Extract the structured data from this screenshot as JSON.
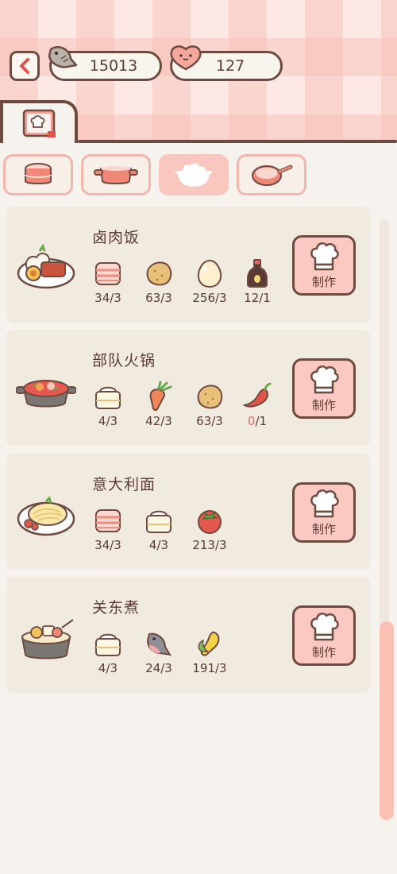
{
  "header": {
    "fish_count": "15013",
    "heart_count": "127"
  },
  "colors": {
    "accent": "#f9c7bd",
    "outline": "#6e4a40",
    "card": "#f1eadf",
    "shortage": "#e46a5e"
  },
  "category_tabs": [
    {
      "icon": "sushi-roll-icon",
      "active": false
    },
    {
      "icon": "pot-icon",
      "active": false
    },
    {
      "icon": "rice-bowl-icon",
      "active": true
    },
    {
      "icon": "frying-pan-icon",
      "active": false
    }
  ],
  "recipes": [
    {
      "name": "卤肉饭",
      "dish_icon": "braised-pork-rice-icon",
      "button_label": "制作",
      "ingredients": [
        {
          "icon": "meat-slab-icon",
          "count": "34/3"
        },
        {
          "icon": "potato-icon",
          "count": "63/3"
        },
        {
          "icon": "egg-icon",
          "count": "256/3"
        },
        {
          "icon": "soy-sauce-icon",
          "count": "12/1"
        }
      ]
    },
    {
      "name": "部队火锅",
      "dish_icon": "army-hotpot-icon",
      "button_label": "制作",
      "ingredients": [
        {
          "icon": "rice-cake-icon",
          "count": "4/3"
        },
        {
          "icon": "carrot-icon",
          "count": "42/3"
        },
        {
          "icon": "potato-icon",
          "count": "63/3"
        },
        {
          "icon": "chili-icon",
          "have": "0",
          "need": "/1"
        }
      ]
    },
    {
      "name": "意大利面",
      "dish_icon": "spaghetti-icon",
      "button_label": "制作",
      "ingredients": [
        {
          "icon": "meat-slab-icon",
          "count": "34/3"
        },
        {
          "icon": "rice-cake-icon",
          "count": "4/3"
        },
        {
          "icon": "tomato-icon",
          "count": "213/3"
        }
      ]
    },
    {
      "name": "关东煮",
      "dish_icon": "oden-icon",
      "button_label": "制作",
      "ingredients": [
        {
          "icon": "rice-cake-icon",
          "count": "4/3"
        },
        {
          "icon": "fish-icon",
          "count": "24/3"
        },
        {
          "icon": "corn-icon",
          "count": "191/3"
        }
      ]
    }
  ]
}
